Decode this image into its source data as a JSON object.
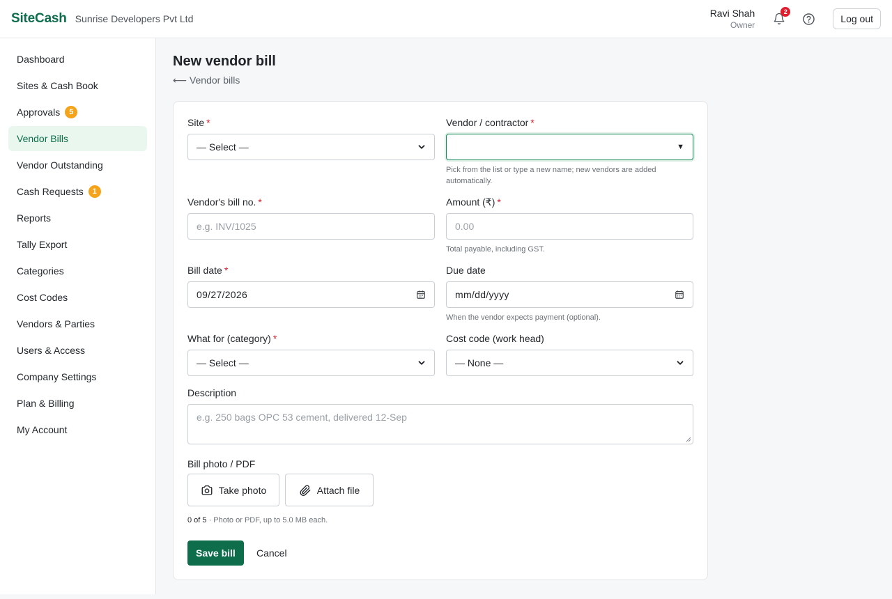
{
  "header": {
    "brand": "SiteCash",
    "company": "Sunrise Developers Pvt Ltd",
    "user_name": "Ravi Shah",
    "user_role": "Owner",
    "notification_count": "2",
    "logout_label": "Log out"
  },
  "sidebar": {
    "items": [
      {
        "label": "Dashboard"
      },
      {
        "label": "Sites & Cash Book"
      },
      {
        "label": "Approvals",
        "badge": "5"
      },
      {
        "label": "Vendor Bills",
        "active": true
      },
      {
        "label": "Vendor Outstanding"
      },
      {
        "label": "Cash Requests",
        "badge": "1"
      },
      {
        "label": "Reports"
      },
      {
        "label": "Tally Export"
      },
      {
        "label": "Categories"
      },
      {
        "label": "Cost Codes"
      },
      {
        "label": "Vendors & Parties"
      },
      {
        "label": "Users & Access"
      },
      {
        "label": "Company Settings"
      },
      {
        "label": "Plan & Billing"
      },
      {
        "label": "My Account"
      }
    ]
  },
  "page": {
    "title": "New vendor bill",
    "back_link": "⟵ Vendor bills"
  },
  "form": {
    "site": {
      "label": "Site",
      "required_mark": "*",
      "value": "— Select —"
    },
    "vendor": {
      "label": "Vendor / contractor",
      "required_mark": "*",
      "value": "",
      "help": "Pick from the list or type a new name; new vendors are added automatically."
    },
    "bill_no": {
      "label": "Vendor's bill no.",
      "required_mark": "*",
      "placeholder": "e.g. INV/1025"
    },
    "amount": {
      "label": "Amount (₹)",
      "required_mark": "*",
      "placeholder": "0.00",
      "help": "Total payable, including GST."
    },
    "bill_date": {
      "label": "Bill date",
      "required_mark": "*",
      "value": "09/27/2026"
    },
    "due_date": {
      "label": "Due date",
      "value": "mm/dd/yyyy",
      "help": "When the vendor expects payment (optional)."
    },
    "category": {
      "label": "What for (category)",
      "required_mark": "*",
      "value": "— Select —"
    },
    "cost_code": {
      "label": "Cost code (work head)",
      "value": "— None —"
    },
    "description": {
      "label": "Description",
      "placeholder": "e.g. 250 bags OPC 53 cement, delivered 12-Sep"
    },
    "attachments": {
      "label": "Bill photo / PDF",
      "take_photo": "Take photo",
      "attach_file": "Attach file",
      "count": "0 of 5",
      "note": " · Photo or PDF, up to 5.0 MB each."
    },
    "save_label": "Save bill",
    "cancel_label": "Cancel"
  }
}
